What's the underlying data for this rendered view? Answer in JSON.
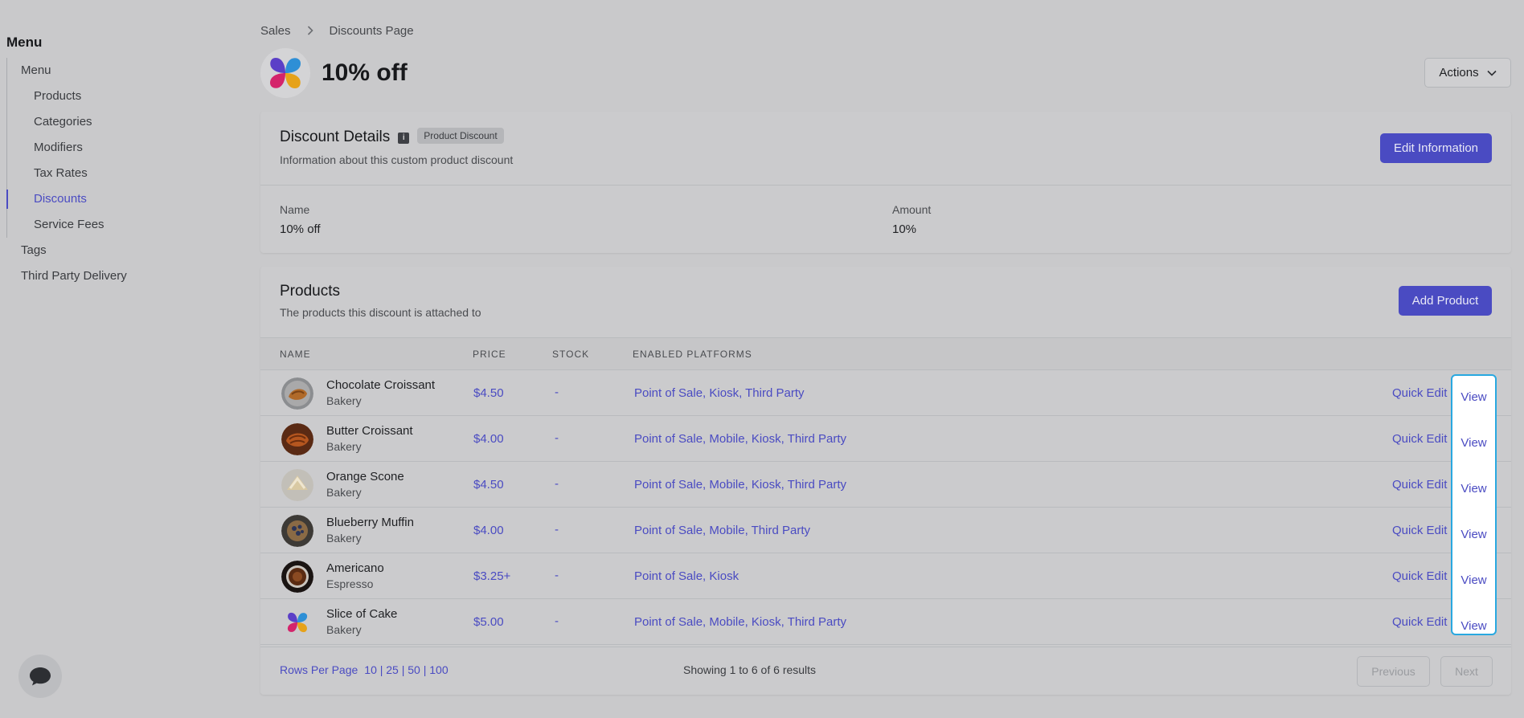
{
  "sidebar": {
    "heading": "Menu",
    "root": "Menu",
    "children": [
      "Products",
      "Categories",
      "Modifiers",
      "Tax Rates",
      "Discounts",
      "Service Fees"
    ],
    "active": "Discounts",
    "top_items": [
      "Tags",
      "Third Party Delivery"
    ]
  },
  "breadcrumb": {
    "parent": "Sales",
    "current": "Discounts Page"
  },
  "page": {
    "title": "10% off",
    "actions_label": "Actions"
  },
  "details": {
    "title": "Discount Details",
    "info_glyph": "i",
    "badge": "Product Discount",
    "subtitle": "Information about this custom product discount",
    "edit_label": "Edit Information",
    "fields": [
      {
        "label": "Name",
        "value": "10% off"
      },
      {
        "label": "Amount",
        "value": "10%"
      }
    ]
  },
  "products": {
    "title": "Products",
    "subtitle": "The products this discount is attached to",
    "add_label": "Add Product",
    "columns": [
      "NAME",
      "PRICE",
      "STOCK",
      "ENABLED PLATFORMS"
    ],
    "rows": [
      {
        "name": "Chocolate Croissant",
        "category": "Bakery",
        "price": "$4.50",
        "stock": "-",
        "platforms": "Point of Sale, Kiosk, Third Party",
        "quick_edit": "Quick Edit",
        "view": "View",
        "thumb": "croissant-dark"
      },
      {
        "name": "Butter Croissant",
        "category": "Bakery",
        "price": "$4.00",
        "stock": "-",
        "platforms": "Point of Sale, Mobile, Kiosk, Third Party",
        "quick_edit": "Quick Edit",
        "view": "View",
        "thumb": "croissant-butter"
      },
      {
        "name": "Orange Scone",
        "category": "Bakery",
        "price": "$4.50",
        "stock": "-",
        "platforms": "Point of Sale, Mobile, Kiosk, Third Party",
        "quick_edit": "Quick Edit",
        "view": "View",
        "thumb": "scone"
      },
      {
        "name": "Blueberry Muffin",
        "category": "Bakery",
        "price": "$4.00",
        "stock": "-",
        "platforms": "Point of Sale, Mobile, Third Party",
        "quick_edit": "Quick Edit",
        "view": "View",
        "thumb": "muffin"
      },
      {
        "name": "Americano",
        "category": "Espresso",
        "price": "$3.25+",
        "stock": "-",
        "platforms": "Point of Sale, Kiosk",
        "quick_edit": "Quick Edit",
        "view": "View",
        "thumb": "coffee"
      },
      {
        "name": "Slice of Cake",
        "category": "Bakery",
        "price": "$5.00",
        "stock": "-",
        "platforms": "Point of Sale, Mobile, Kiosk, Third Party",
        "quick_edit": "Quick Edit",
        "view": "View",
        "thumb": "brand-logo"
      }
    ]
  },
  "pagination": {
    "rows_per_page_label": "Rows Per Page",
    "rows_per_page_options": "10 | 25 | 50 | 100",
    "showing_prefix": "Showing",
    "from": "1",
    "to_word": "to",
    "to": "6",
    "of_word": "of",
    "total": "6",
    "results_word": "results",
    "previous_label": "Previous",
    "next_label": "Next"
  },
  "colors": {
    "accent": "#4a4bc2",
    "highlight_border": "#29a8e0"
  },
  "icons": {
    "logo": "pinwheel-logo-icon",
    "chat": "chat-bubble-icon",
    "chevron": "chevron-down-icon",
    "info": "info-icon",
    "breadcrumb_sep": "chevron-right-icon"
  }
}
